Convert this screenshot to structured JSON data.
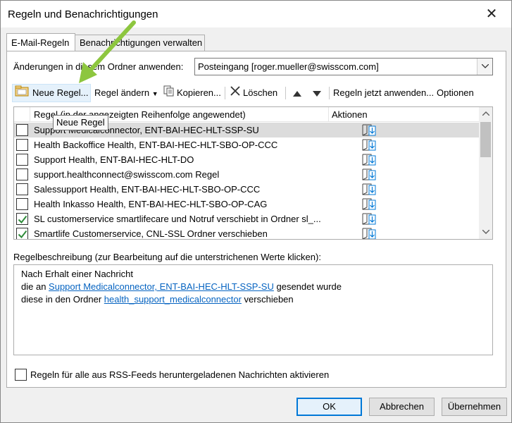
{
  "window": {
    "title": "Regeln und Benachrichtigungen",
    "close_symbol": "✕"
  },
  "tabs": [
    {
      "label": "E-Mail-Regeln",
      "active": true
    },
    {
      "label": "Benachrichtigungen verwalten",
      "active": false
    }
  ],
  "folder": {
    "label": "Änderungen in diesem Ordner anwenden:",
    "value": "Posteingang [roger.mueller@swisscom.com]"
  },
  "toolbar": {
    "new_rule": "Neue Regel...",
    "change_rule": "Regel ändern",
    "copy": "Kopieren...",
    "delete": "Löschen",
    "run_now": "Regeln jetzt anwenden...",
    "options": "Optionen"
  },
  "rules_list": {
    "header_rule": "Regel (in der angezeigten Reihenfolge angewendet)",
    "header_actions": "Aktionen",
    "rows": [
      {
        "name": "Support Medicalconnector, ENT-BAI-HEC-HLT-SSP-SU",
        "checked": false,
        "selected": true
      },
      {
        "name": "Health Backoffice Health, ENT-BAI-HEC-HLT-SBO-OP-CCC",
        "checked": false,
        "selected": false
      },
      {
        "name": "Support Health, ENT-BAI-HEC-HLT-DO",
        "checked": false,
        "selected": false
      },
      {
        "name": "support.healthconnect@swisscom.com Regel",
        "checked": false,
        "selected": false
      },
      {
        "name": "Salessupport Health, ENT-BAI-HEC-HLT-SBO-OP-CCC",
        "checked": false,
        "selected": false
      },
      {
        "name": "Health Inkasso Health, ENT-BAI-HEC-HLT-SBO-OP-CAG",
        "checked": false,
        "selected": false
      },
      {
        "name": "SL customerservice smartlifecare und Notruf verschiebt in Ordner sl_...",
        "checked": true,
        "selected": false
      },
      {
        "name": "Smartlife Customerservice, CNL-SSL Ordner verschieben",
        "checked": true,
        "selected": false
      }
    ]
  },
  "tooltip": "Neue Regel",
  "description": {
    "label": "Regelbeschreibung (zur Bearbeitung auf die unterstrichenen Werte klicken):",
    "line1": "Nach Erhalt einer Nachricht",
    "line2_prefix": "die an ",
    "line2_link": "Support Medicalconnector, ENT-BAI-HEC-HLT-SSP-SU",
    "line2_suffix": " gesendet wurde",
    "line3_prefix": "diese in den Ordner ",
    "line3_link": "health_support_medicalconnector",
    "line3_suffix": " verschieben"
  },
  "rss_checkbox": {
    "label": "Regeln für alle aus RSS-Feeds heruntergeladenen Nachrichten aktivieren",
    "checked": false
  },
  "buttons": {
    "ok": "OK",
    "cancel": "Abbrechen",
    "apply": "Übernehmen"
  },
  "colors": {
    "accent": "#0078d7",
    "link": "#0563c1",
    "annotation_arrow": "#8dc63f",
    "check": "#2e8b3a"
  },
  "icons": {
    "new_rule": "new-rule-icon",
    "copy": "copy-icon",
    "delete": "delete-x-icon",
    "move_up": "triangle-up-icon",
    "move_down": "triangle-down-icon",
    "action": "move-to-folder-icon"
  }
}
